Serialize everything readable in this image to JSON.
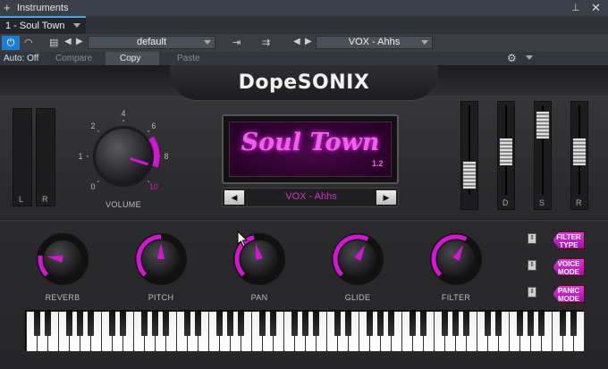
{
  "host": {
    "window_title": "Instruments",
    "instance_tab": "1 - Soul Town",
    "preset": "default",
    "program": "VOX - Ahhs",
    "auto_label": "Auto: Off",
    "compare_label": "Compare",
    "copy_label": "Copy",
    "paste_label": "Paste"
  },
  "plugin": {
    "brand": "DopeSONIX",
    "display_title": "Soul Town",
    "version": "1.2",
    "preset_name": "VOX - Ahhs",
    "volume_label": "VOLUME",
    "volume_ticks": [
      "0",
      "1",
      "2",
      "4",
      "6",
      "8",
      "10"
    ],
    "volume_level": 0.9,
    "meter_left": "L",
    "meter_right": "R",
    "fader_labels": [
      "",
      "D",
      "S",
      "R"
    ],
    "knobs": [
      {
        "label": "REVERB",
        "value": 0.2
      },
      {
        "label": "PITCH",
        "value": 0.5
      },
      {
        "label": "PAN",
        "value": 0.45
      },
      {
        "label": "GLIDE",
        "value": 0.6
      },
      {
        "label": "FILTER",
        "value": 0.6
      }
    ],
    "side_buttons": [
      {
        "label": "FILTER TYPE"
      },
      {
        "label": "VOICE MODE"
      },
      {
        "label": "PANIC MODE"
      }
    ],
    "accent": "#d415d4"
  }
}
